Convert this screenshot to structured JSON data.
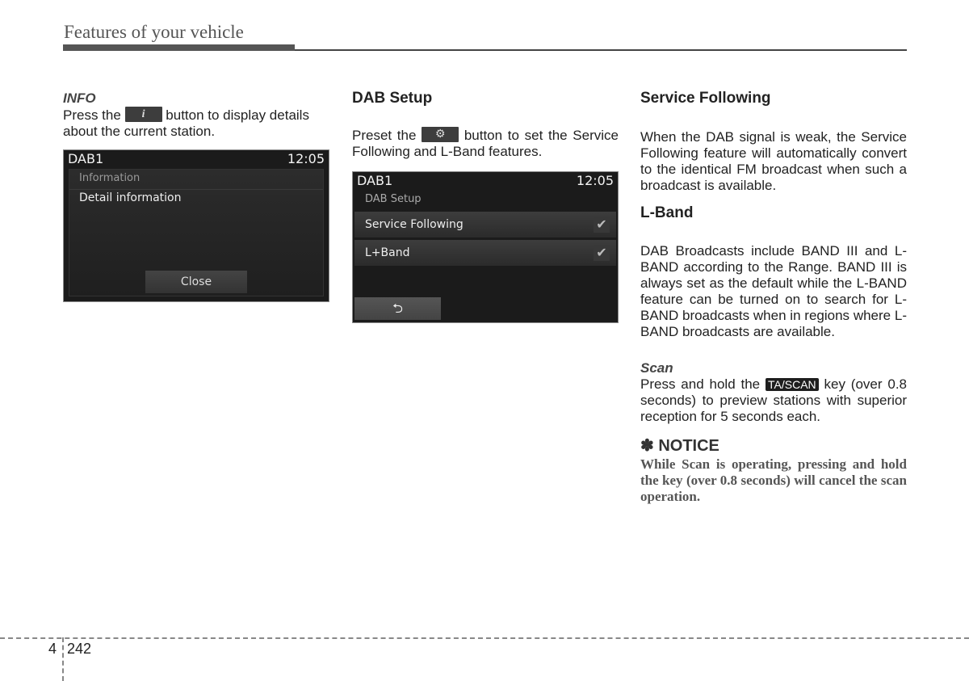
{
  "header": {
    "title": "Features of your vehicle"
  },
  "col1": {
    "subheading": "INFO",
    "text_before": "Press the",
    "button_icon": "info-icon",
    "button_glyph": "i",
    "text_after": "button to display details about the current station.",
    "screen": {
      "station": "DAB1",
      "time": "12:05",
      "panel_title": "Information",
      "item": "Detail information",
      "close_label": "Close"
    }
  },
  "col2": {
    "heading": "DAB Setup",
    "text_before": "Preset the",
    "button_icon": "gear-icon",
    "button_glyph": "⚙",
    "text_after": "button to set the Service Following and L-Band features.",
    "screen": {
      "station": "DAB1",
      "time": "12:05",
      "panel_title": "DAB Setup",
      "options": [
        {
          "label": "Service Following",
          "checked": true
        },
        {
          "label": "L+Band",
          "checked": true
        }
      ],
      "check_glyph": "✔",
      "back_glyph": "⮌"
    }
  },
  "col3": {
    "heading1": "Service Following",
    "para1": "When the DAB signal is weak, the Service Following feature will automatically convert to the identical FM broadcast when such a broadcast is available.",
    "heading2": "L-Band",
    "para2": "DAB Broadcasts include BAND III and L-BAND according to the Range. BAND III is always set as the default while the L-BAND feature can be turned on to search for L-BAND broadcasts when in regions where L-BAND broadcasts are available.",
    "scan_heading": "Scan",
    "scan_before": "Press and hold the",
    "scan_key": "TA/SCAN",
    "scan_after": "key (over 0.8 seconds) to preview stations with superior reception for 5 seconds each.",
    "notice_heading": "✽ NOTICE",
    "notice_text": "While Scan is operating, pressing and hold the key (over 0.8 seconds) will cancel the scan operation."
  },
  "footer": {
    "chapter": "4",
    "page": "242"
  }
}
